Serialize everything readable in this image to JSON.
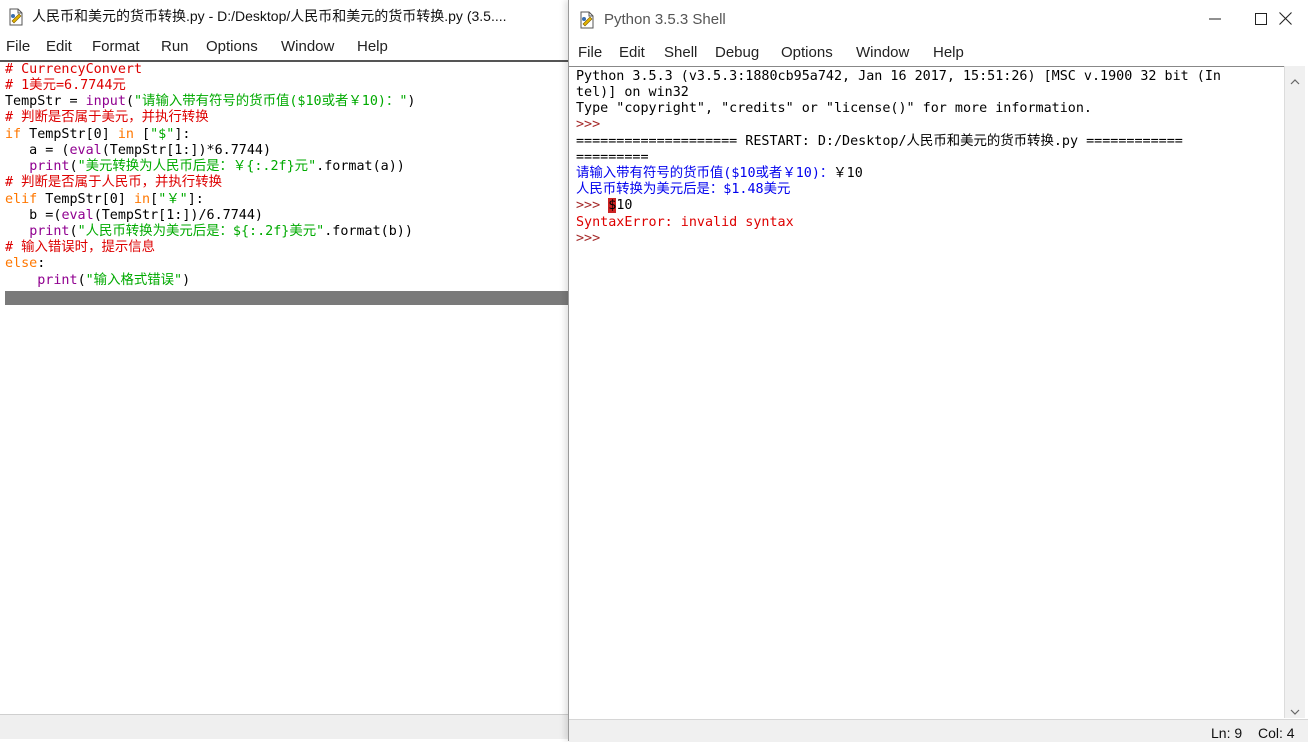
{
  "editor": {
    "title": "人民币和美元的货币转换.py - D:/Desktop/人民币和美元的货币转换.py (3.5....",
    "menu": [
      "File",
      "Edit",
      "Format",
      "Run",
      "Options",
      "Window",
      "Help"
    ],
    "code_lines": [
      [
        {
          "t": "# CurrencyConvert",
          "c": "comment"
        }
      ],
      [
        {
          "t": "# 1美元=6.7744元",
          "c": "comment"
        }
      ],
      [
        {
          "t": "TempStr = ",
          "c": "normal"
        },
        {
          "t": "input",
          "c": "builtin"
        },
        {
          "t": "(",
          "c": "normal"
        },
        {
          "t": "\"请输入带有符号的货币值($10或者￥10)：\"",
          "c": "string"
        },
        {
          "t": ")",
          "c": "normal"
        }
      ],
      [
        {
          "t": "# 判断是否属于美元，并执行转换",
          "c": "comment"
        }
      ],
      [
        {
          "t": "if",
          "c": "keyword"
        },
        {
          "t": " TempStr[0] ",
          "c": "normal"
        },
        {
          "t": "in",
          "c": "keyword"
        },
        {
          "t": " [",
          "c": "normal"
        },
        {
          "t": "\"$\"",
          "c": "string"
        },
        {
          "t": "]:",
          "c": "normal"
        }
      ],
      [
        {
          "t": "   a = (",
          "c": "normal"
        },
        {
          "t": "eval",
          "c": "builtin"
        },
        {
          "t": "(TempStr[1:])*6.7744)",
          "c": "normal"
        }
      ],
      [
        {
          "t": "   ",
          "c": "normal"
        },
        {
          "t": "print",
          "c": "builtin"
        },
        {
          "t": "(",
          "c": "normal"
        },
        {
          "t": "\"美元转换为人民币后是：￥{:.2f}元\"",
          "c": "string"
        },
        {
          "t": ".format(a))",
          "c": "normal"
        }
      ],
      [
        {
          "t": "# 判断是否属于人民币，并执行转换",
          "c": "comment"
        }
      ],
      [
        {
          "t": "elif",
          "c": "keyword"
        },
        {
          "t": " TempStr[0] ",
          "c": "normal"
        },
        {
          "t": "in",
          "c": "keyword"
        },
        {
          "t": "[",
          "c": "normal"
        },
        {
          "t": "\"￥\"",
          "c": "string"
        },
        {
          "t": "]:",
          "c": "normal"
        }
      ],
      [
        {
          "t": "   b =(",
          "c": "normal"
        },
        {
          "t": "eval",
          "c": "builtin"
        },
        {
          "t": "(TempStr[1:])/6.7744)",
          "c": "normal"
        }
      ],
      [
        {
          "t": "   ",
          "c": "normal"
        },
        {
          "t": "print",
          "c": "builtin"
        },
        {
          "t": "(",
          "c": "normal"
        },
        {
          "t": "\"人民币转换为美元后是：${:.2f}美元\"",
          "c": "string"
        },
        {
          "t": ".format(b))",
          "c": "normal"
        }
      ],
      [
        {
          "t": "# 输入错误时，提示信息",
          "c": "comment"
        }
      ],
      [
        {
          "t": "else",
          "c": "keyword"
        },
        {
          "t": ":",
          "c": "normal"
        }
      ],
      [
        {
          "t": "    ",
          "c": "normal"
        },
        {
          "t": "print",
          "c": "builtin"
        },
        {
          "t": "(",
          "c": "normal"
        },
        {
          "t": "\"输入格式错误\"",
          "c": "string"
        },
        {
          "t": ")",
          "c": "normal"
        }
      ]
    ]
  },
  "shell": {
    "title": "Python 3.5.3 Shell",
    "menu": [
      "File",
      "Edit",
      "Shell",
      "Debug",
      "Options",
      "Window",
      "Help"
    ],
    "window_buttons": {
      "minimize": "minimize",
      "maximize": "maximize",
      "close": "close"
    },
    "output_lines": [
      [
        {
          "t": "Python 3.5.3 (v3.5.3:1880cb95a742, Jan 16 2017, 15:51:26) [MSC v.1900 32 bit (In",
          "c": "black"
        }
      ],
      [
        {
          "t": "tel)] on win32",
          "c": "black"
        }
      ],
      [
        {
          "t": "Type \"copyright\", \"credits\" or \"license()\" for more information.",
          "c": "black"
        }
      ],
      [
        {
          "t": ">>>",
          "c": "prompt"
        }
      ],
      [
        {
          "t": "==================== RESTART: D:/Desktop/人民币和美元的货币转换.py ============",
          "c": "black"
        }
      ],
      [
        {
          "t": "=========",
          "c": "black"
        }
      ],
      [
        {
          "t": "请输入带有符号的货币值($10或者￥10)：",
          "c": "blue"
        },
        {
          "t": "￥10",
          "c": "black"
        }
      ],
      [
        {
          "t": "人民币转换为美元后是：$1.48美元",
          "c": "blue"
        }
      ],
      [
        {
          "t": ">>> ",
          "c": "prompt"
        },
        {
          "t": "$",
          "c": "cursor"
        },
        {
          "t": "10",
          "c": "black"
        }
      ],
      [
        {
          "t": "SyntaxError: invalid syntax",
          "c": "red"
        }
      ],
      [
        {
          "t": ">>>",
          "c": "prompt"
        }
      ]
    ],
    "status": {
      "ln": "Ln: 9",
      "col": "Col: 4"
    }
  }
}
